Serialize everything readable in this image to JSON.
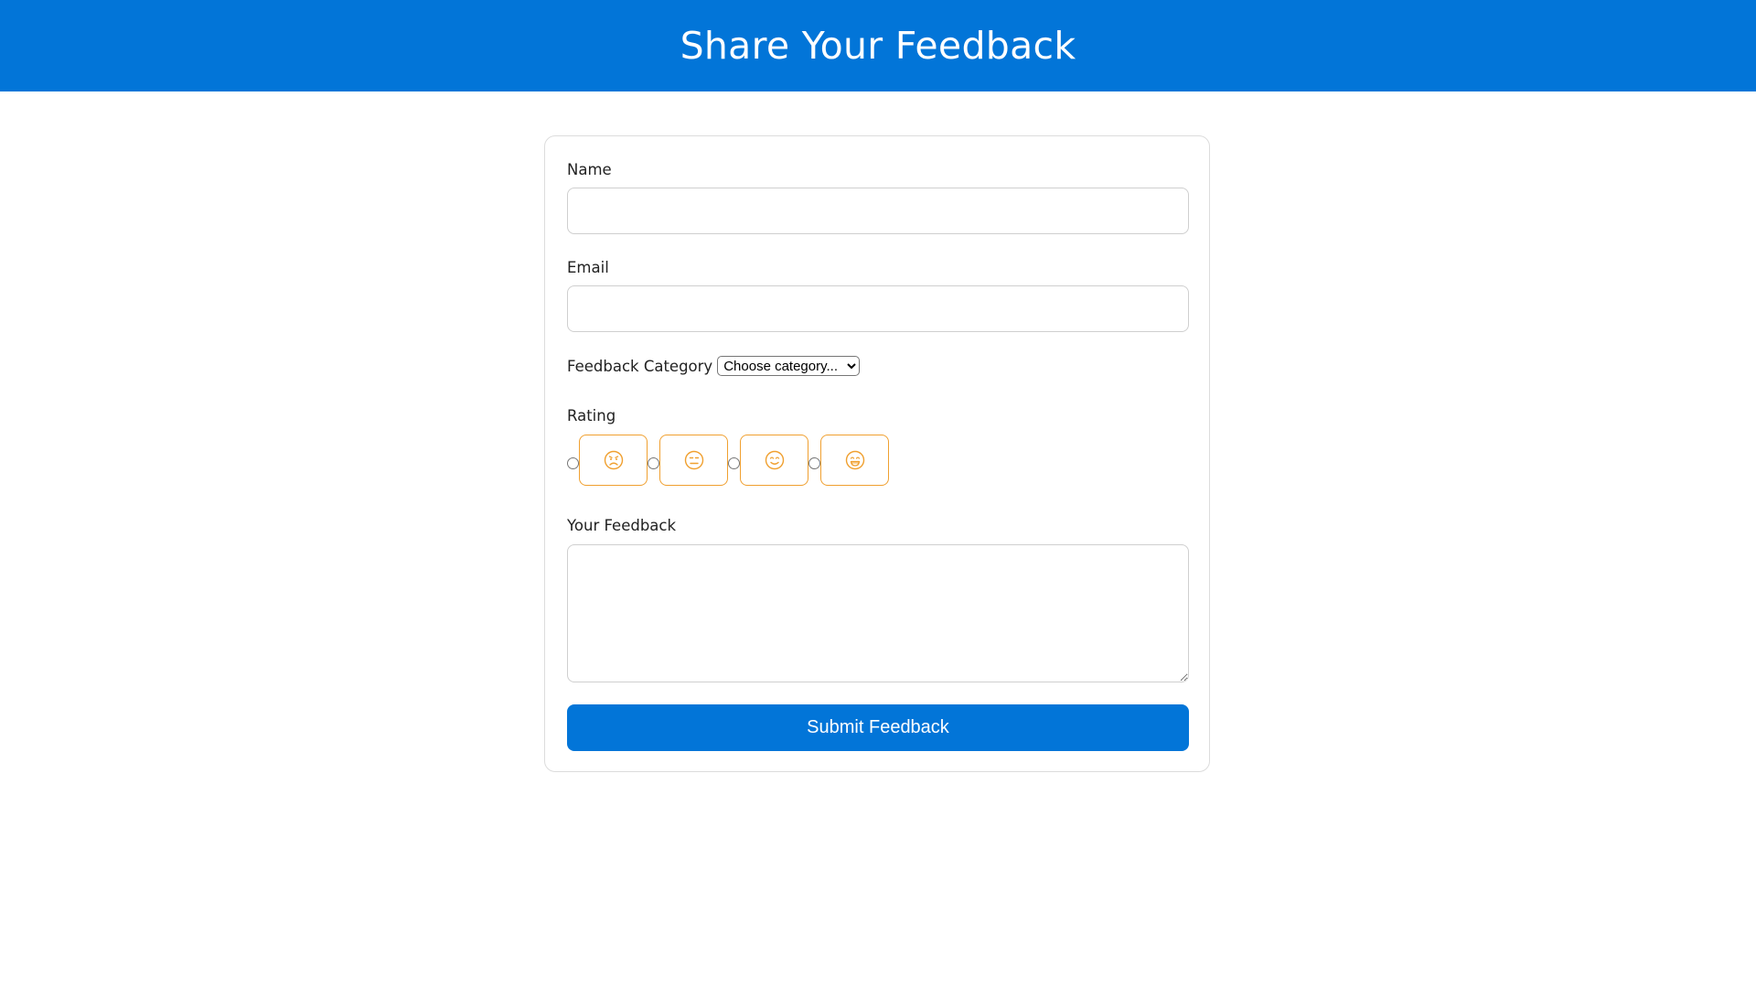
{
  "header": {
    "title": "Share Your Feedback"
  },
  "form": {
    "name": {
      "label": "Name",
      "value": ""
    },
    "email": {
      "label": "Email",
      "value": ""
    },
    "category": {
      "label": "Feedback Category",
      "selected": "Choose category..."
    },
    "rating": {
      "label": "Rating",
      "options": [
        {
          "icon": "frown-face-icon"
        },
        {
          "icon": "neutral-face-icon"
        },
        {
          "icon": "slight-smile-face-icon"
        },
        {
          "icon": "grin-face-icon"
        }
      ],
      "accent_color": "#f0a030"
    },
    "feedback": {
      "label": "Your Feedback",
      "value": ""
    },
    "submit_label": "Submit Feedback"
  },
  "colors": {
    "brand": "#0275d8",
    "accent": "#f0a030"
  }
}
